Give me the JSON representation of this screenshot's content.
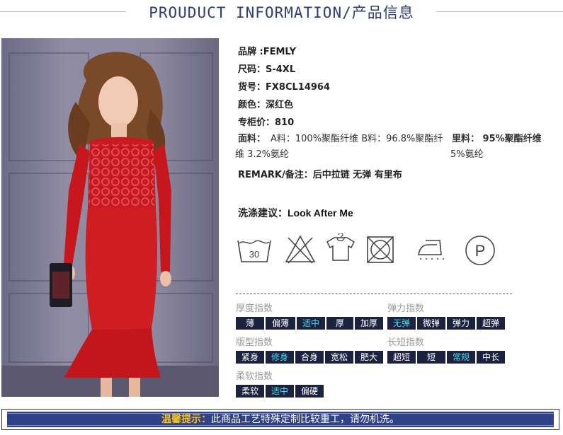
{
  "header": {
    "title": "PROUDUCT INFORMATION/产品信息"
  },
  "info": {
    "brand": "品牌 :FEMLY",
    "size": "尺码：S-4XL",
    "sku": "货号：FX8CL14964",
    "color": "颜色：深红色",
    "price": "专柜价：810",
    "fabric_label": "面料：",
    "fabric_a_line1": "A料：100%聚酯纤维 B料：96.8%聚酯纤",
    "fabric_a_line2": "维 3.2%氨纶",
    "lining_line1": "里料： 95%聚酯纤维",
    "lining_line2": "5%氨纶",
    "remark": "REMARK/备注：后中拉链 无弹 有里布",
    "wash_label": "洗涤建议：",
    "wash_value": "Look After Me",
    "wash_temp": "30"
  },
  "wash_icons": [
    "wash-30-icon",
    "no-bleach-icon",
    "hang-dry-icon",
    "no-tumble-dry-icon",
    "iron-low-icon",
    "dry-clean-p-icon"
  ],
  "indices": {
    "thickness": {
      "label": "厚度指数",
      "options": [
        "薄",
        "偏薄",
        "适中",
        "厚",
        "加厚"
      ],
      "selected": "适中"
    },
    "elasticity": {
      "label": "弹力指数",
      "options": [
        "无弹",
        "微弹",
        "弹力",
        "超弹"
      ],
      "selected": "无弹"
    },
    "fit": {
      "label": "版型指数",
      "options": [
        "紧身",
        "修身",
        "合身",
        "宽松",
        "肥大"
      ],
      "selected": "修身"
    },
    "length": {
      "label": "长短指数",
      "options": [
        "超短",
        "短",
        "常规",
        "中长"
      ],
      "selected": "常规"
    },
    "softness": {
      "label": "柔软指数",
      "options": [
        "柔软",
        "适中",
        "偏硬"
      ],
      "selected": "适中"
    }
  },
  "footer": {
    "highlight": "温馨提示：",
    "text": "此商品工艺特殊定制比较重工，请勿机洗。"
  },
  "colors": {
    "accent": "#2d3b7a",
    "tag_bg": "#1c2340",
    "tag_selected_text": "#3de0f0",
    "footer_bar": "#2f4287",
    "footer_highlight": "#f4c21b",
    "dress": "#d01d22"
  }
}
